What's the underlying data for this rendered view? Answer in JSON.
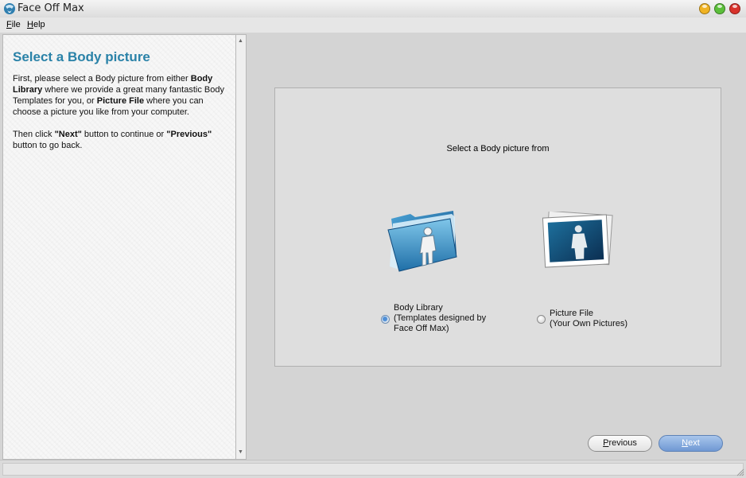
{
  "window": {
    "title": "Face Off Max",
    "icon": "face-off-max-app-icon",
    "controls": [
      {
        "name": "minimize",
        "color": "#f0b323"
      },
      {
        "name": "maximize",
        "color": "#5bbf3a"
      },
      {
        "name": "close",
        "color": "#d8322b"
      }
    ]
  },
  "menu": {
    "file": {
      "mnemonic": "F",
      "rest": "ile"
    },
    "help": {
      "mnemonic": "H",
      "rest": "elp"
    }
  },
  "left_panel": {
    "title": "Select a Body picture",
    "paragraph1": {
      "t1": "First, please select a Body picture from either ",
      "b1": "Body Library",
      "t2": " where we provide a great many fantastic Body Templates for you, or ",
      "b2": "Picture File",
      "t3": " where you can choose a picture you like from your computer."
    },
    "paragraph2": {
      "t1": "Then click ",
      "b1": "\"Next\"",
      "t2": " button to continue or ",
      "b2": "\"Previous\"",
      "t3": " button to go back."
    }
  },
  "choice": {
    "heading": "Select a Body picture from",
    "options": [
      {
        "icon": "folder-person-icon",
        "line1": "Body Library",
        "line2": "(Templates designed by",
        "line3": "Face Off Max)",
        "selected": true
      },
      {
        "icon": "photo-person-icon",
        "line1": "Picture File",
        "line2": "(Your Own Pictures)",
        "selected": false
      }
    ]
  },
  "buttons": {
    "previous": {
      "mnemonic": "P",
      "rest": "revious"
    },
    "next": {
      "mnemonic": "N",
      "rest": "ext"
    }
  },
  "colors": {
    "accent_title": "#2a82a8",
    "next_button": "#6f98d3",
    "background": "#d4d4d4"
  }
}
